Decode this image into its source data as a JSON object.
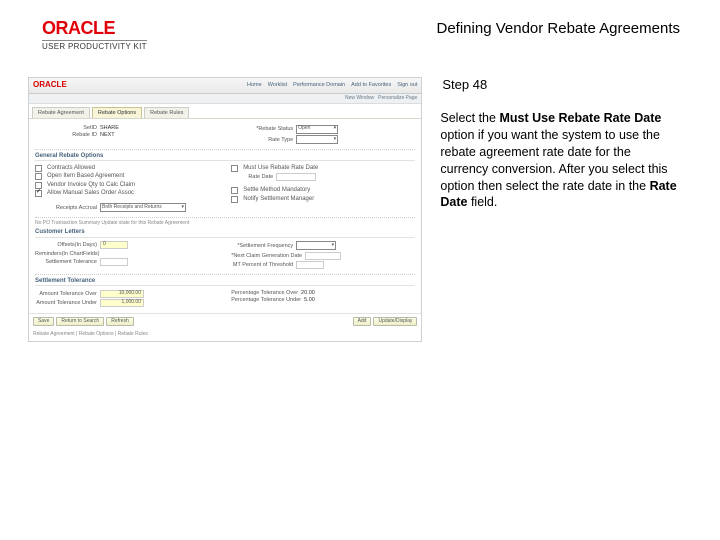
{
  "header": {
    "brand": "ORACLE",
    "upk": "USER PRODUCTIVITY KIT",
    "title": "Defining Vendor Rebate Agreements"
  },
  "step": "Step 48",
  "description": {
    "pre": "Select the ",
    "bold1": "Must Use Rebate Rate Date",
    "mid": " option if you want the system to use the rebate agreement rate date for the currency conversion. After you select this option then select the rate date in the ",
    "bold2": "Rate Date",
    "post": " field."
  },
  "shot": {
    "nav": [
      "Home",
      "Worklist",
      "Performance Domain",
      "Add to Favorites",
      "Sign out"
    ],
    "bar2": [
      "New Window",
      "Personalize Page"
    ],
    "tabs": [
      "Rebate Agreement",
      "Rebate Options",
      "Rebate Rules"
    ],
    "top": {
      "setid_lbl": "SetID",
      "setid": "SHARE",
      "rebateid_lbl": "Rebate ID",
      "rebateid": "NEXT",
      "status_lbl": "*Rebate Status",
      "status": "Open",
      "rtype_lbl": "Rate Type"
    },
    "gen": {
      "header": "General Rebate Options",
      "opt1": "Contracts Allowed",
      "opt2": "Open Item Based Agreement",
      "opt3": "Vendor Invoice Qty to Calc Claim",
      "opt4": "Allow Manual Sales Order Assoc",
      "mustuse": "Must Use Rebate Rate Date",
      "ratedate_lbl": "Rate Date",
      "receipt_lbl": "Receipts Accrual",
      "receipt": "Both Receipts and Returns",
      "v1": "Settle Method Mandatory",
      "v2": "Notify Settlement Manager",
      "txt": "No PO Transaction Summary Update state for this Rebate Agreement"
    },
    "cust": {
      "header": "Customer Letters",
      "off_lbl": "Offsets(In Days)",
      "off_v": "0",
      "rem_lbl": "Reminders(In ChartFields)",
      "setf_lbl": "*Settlement Frequency",
      "claim_lbl": "*Next Claim Generation Date",
      "settle_lbl": "Settlement Tolerance",
      "minpct_lbl": "MT Percent of Threshold"
    },
    "tol": {
      "header": "Settlement Tolerance",
      "ato_lbl": "Amount Tolerance Over",
      "ato": "10,000.00",
      "atu_lbl": "Amount Tolerance Under",
      "atu": "1,000.00",
      "pto_lbl": "Percentage Tolerance Over",
      "pto": "20.00",
      "ptu_lbl": "Percentage Tolerance Under",
      "ptu": "5.00"
    },
    "btns": {
      "save": "Save",
      "return": "Return to Search",
      "refresh": "Refresh",
      "add": "Add",
      "update": "Update/Display"
    },
    "footer": "Rebate Agreement | Rebate Options | Rebate Rules"
  }
}
